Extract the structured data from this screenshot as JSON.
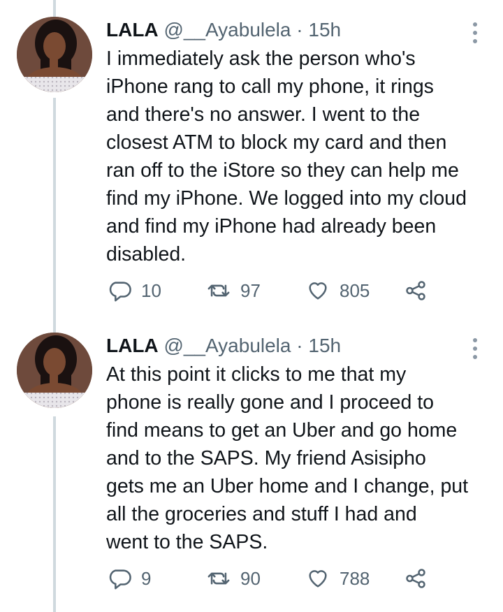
{
  "tweets": [
    {
      "name": "LALA",
      "handle": "@__Ayabulela",
      "separator": "·",
      "time": "15h",
      "text": "I immediately ask the person who's\niPhone rang to call my phone, it rings\nand there's no answer. I went to the\nclosest ATM to block my card and then\nran off to the iStore so they can help me\nfind my iPhone. We logged into my cloud\nand find my iPhone had already been\ndisabled.",
      "replies": "10",
      "retweets": "97",
      "likes": "805"
    },
    {
      "name": "LALA",
      "handle": "@__Ayabulela",
      "separator": "·",
      "time": "15h",
      "text": "At this point it clicks to me that my\nphone is really gone and I proceed to\nfind means to get an Uber and go home\nand to the SAPS. My friend Asisipho\ngets me an Uber home and I change, put\nall the groceries and stuff I had and\nwent to the SAPS.",
      "replies": "9",
      "retweets": "90",
      "likes": "788"
    }
  ],
  "icons": {
    "reply": "reply-icon",
    "retweet": "retweet-icon",
    "like": "heart-icon",
    "share": "share-icon",
    "more": "more-vertical-icon"
  }
}
